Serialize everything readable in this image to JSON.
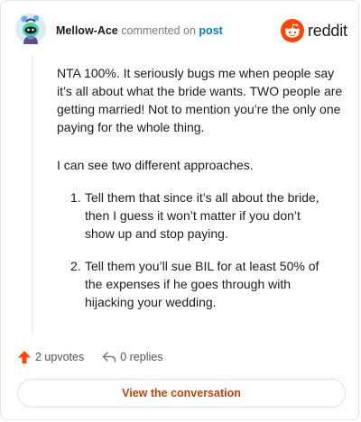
{
  "header": {
    "username": "Mellow-Ace",
    "commented_on": "commented on",
    "post_link": "post"
  },
  "brand": {
    "wordmark": "reddit",
    "icon": "reddit-alien-icon",
    "color": "#ff4500"
  },
  "comment": {
    "paragraphs": [
      "NTA 100%. It seriously bugs me when people say it’s all about what the bride wants. TWO people are getting married! Not to mention you’re the only one paying for the whole thing.",
      "I can see two different approaches."
    ],
    "list": [
      {
        "num": "1.",
        "text": "Tell them that since it’s all about the bride, then I guess it won’t matter if you don’t show up and stop paying."
      },
      {
        "num": "2.",
        "text": "Tell them you’ll sue BIL for at least 50% of the expenses if he goes through with hijacking your wedding."
      }
    ]
  },
  "stats": {
    "upvotes": "2 upvotes",
    "replies": "0 replies",
    "upvote_icon": "upvote-arrow-icon",
    "reply_icon": "reply-arrow-icon",
    "upvote_color": "#ff4500"
  },
  "cta": {
    "label": "View the conversation"
  }
}
